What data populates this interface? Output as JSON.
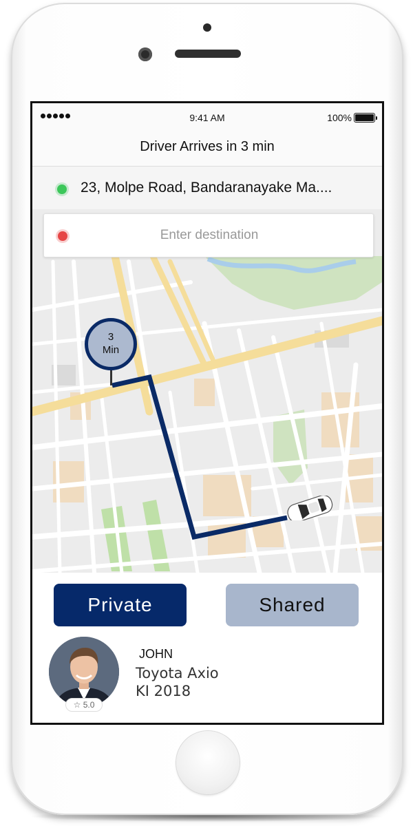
{
  "status_bar": {
    "time": "9:41 AM",
    "battery": "100%"
  },
  "header": {
    "title": "Driver Arrives in 3 min"
  },
  "pickup": {
    "address": "23, Molpe Road, Bandaranayake Ma...."
  },
  "destination": {
    "placeholder": "Enter destination"
  },
  "map": {
    "eta_value": "3",
    "eta_unit": "Min"
  },
  "ride_options": {
    "private_label": "Private",
    "shared_label": "Shared",
    "selected": "Private"
  },
  "driver": {
    "name": "JOHN",
    "car_model": "Toyota Axio",
    "car_plate": "KI 2018",
    "rating": "5.0"
  },
  "colors": {
    "primary": "#06296a",
    "secondary": "#a8b6cc",
    "pickup_dot": "#3cc75a",
    "destination_dot": "#e64545",
    "route": "#0a2a66"
  },
  "icons": [
    "signal-dots-icon",
    "battery-icon",
    "pickup-dot-icon",
    "destination-dot-icon",
    "car-icon",
    "star-icon"
  ]
}
